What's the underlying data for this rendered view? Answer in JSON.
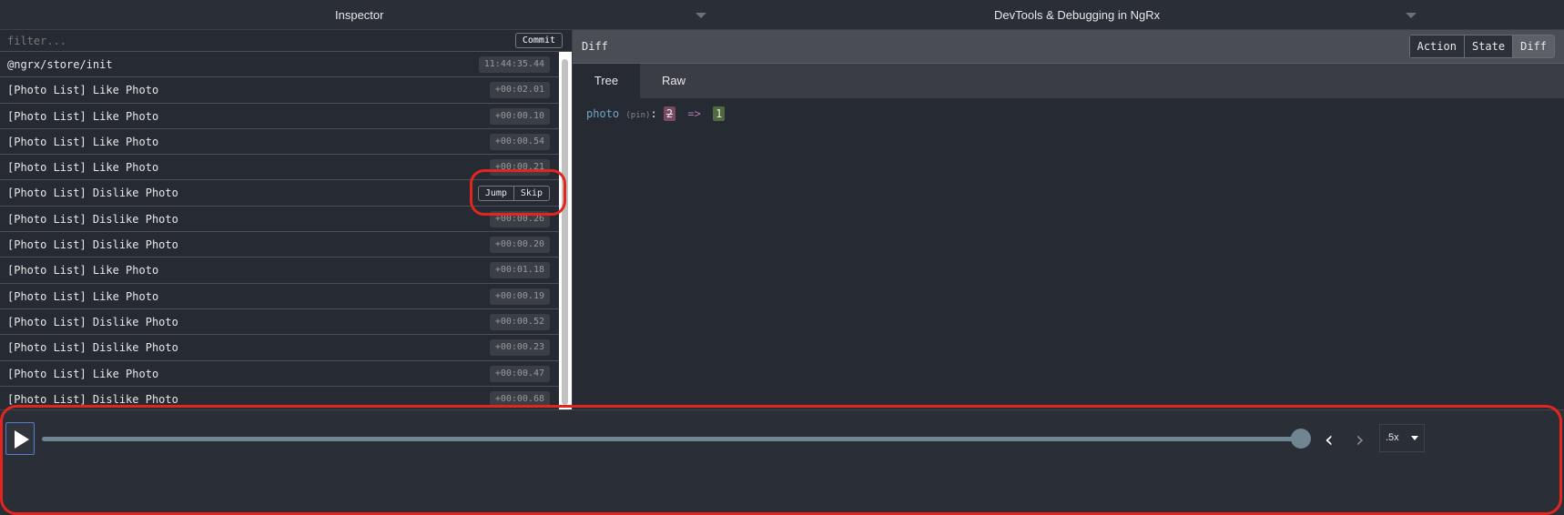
{
  "topbar": {
    "left_title": "Inspector",
    "right_title": "DevTools & Debugging in NgRx"
  },
  "filter": {
    "placeholder": "filter...",
    "commit_label": "Commit"
  },
  "actions": [
    {
      "label": "@ngrx/store/init",
      "time": "11:44:35.44"
    },
    {
      "label": "[Photo List] Like Photo",
      "time": "+00:02.01"
    },
    {
      "label": "[Photo List] Like Photo",
      "time": "+00:00.10"
    },
    {
      "label": "[Photo List] Like Photo",
      "time": "+00:00.54"
    },
    {
      "label": "[Photo List] Like Photo",
      "time": "+00:00.21"
    },
    {
      "label": "[Photo List] Dislike Photo",
      "time": "",
      "jump": "Jump",
      "skip": "Skip"
    },
    {
      "label": "[Photo List] Dislike Photo",
      "time": "+00:00.26"
    },
    {
      "label": "[Photo List] Dislike Photo",
      "time": "+00:00.20"
    },
    {
      "label": "[Photo List] Like Photo",
      "time": "+00:01.18"
    },
    {
      "label": "[Photo List] Like Photo",
      "time": "+00:00.19"
    },
    {
      "label": "[Photo List] Dislike Photo",
      "time": "+00:00.52"
    },
    {
      "label": "[Photo List] Dislike Photo",
      "time": "+00:00.23"
    },
    {
      "label": "[Photo List] Like Photo",
      "time": "+00:00.47"
    },
    {
      "label": "[Photo List] Dislike Photo",
      "time": "+00:00.68"
    }
  ],
  "diff": {
    "label": "Diff",
    "modes": [
      "Action",
      "State",
      "Diff"
    ],
    "active_mode": "Diff",
    "tabs": [
      "Tree",
      "Raw"
    ],
    "active_tab": "Tree",
    "entry": {
      "key": "photo",
      "hint": "(pin)",
      "colon": ":",
      "old": "2",
      "arrow": "=>",
      "new": "1"
    }
  },
  "player": {
    "progress_percent": 100,
    "speed": ".5x",
    "prev_icon": "chevron-left",
    "next_icon": "chevron-right",
    "play_icon": "play"
  },
  "colors": {
    "highlight": "#e3261d"
  }
}
